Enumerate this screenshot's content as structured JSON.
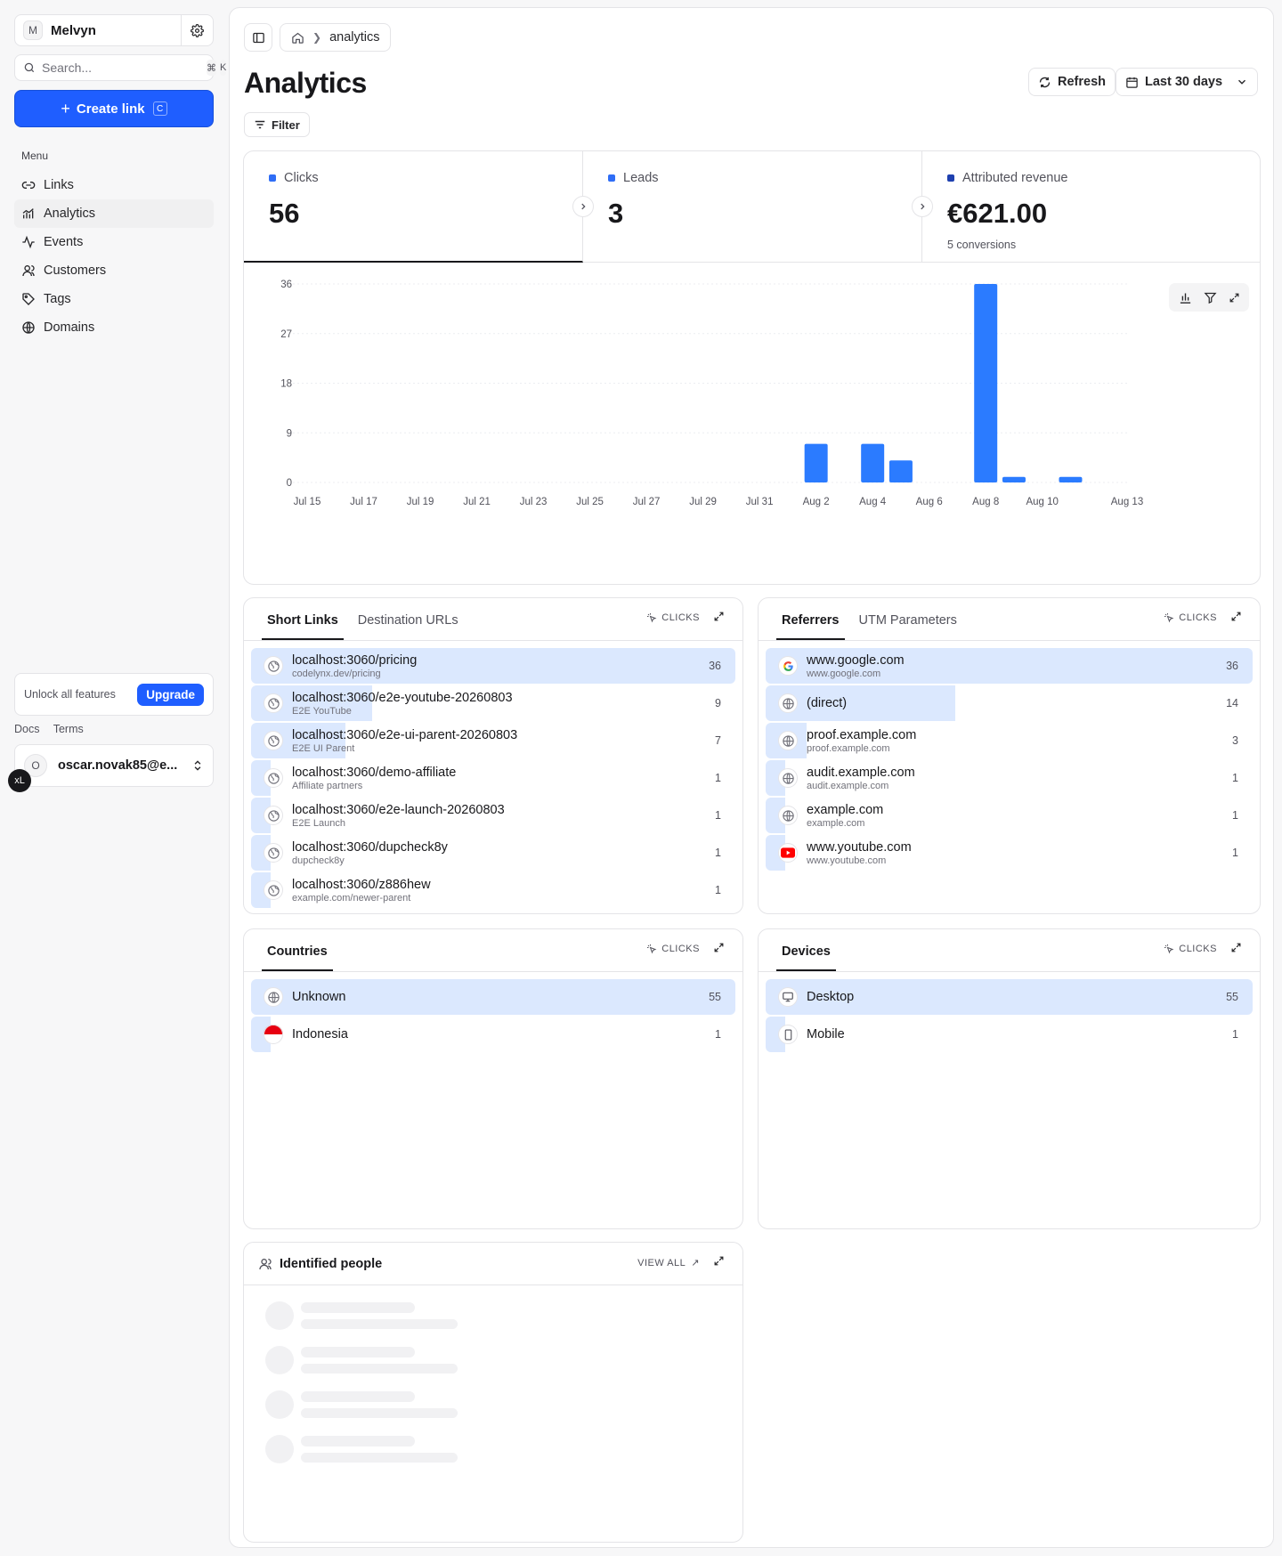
{
  "sidebar": {
    "workspace": {
      "avatar": "M",
      "name": "Melvyn"
    },
    "search": {
      "placeholder": "Search...",
      "kbd1": "⌘",
      "kbd2": "K"
    },
    "create": {
      "label": "Create link",
      "kbd": "C"
    },
    "menu_heading": "Menu",
    "items": [
      {
        "label": "Links",
        "icon": "link-icon"
      },
      {
        "label": "Analytics",
        "icon": "analytics-icon",
        "active": true
      },
      {
        "label": "Events",
        "icon": "activity-icon"
      },
      {
        "label": "Customers",
        "icon": "users-icon"
      },
      {
        "label": "Tags",
        "icon": "tag-icon"
      },
      {
        "label": "Domains",
        "icon": "globe-icon"
      }
    ],
    "unlock": {
      "text": "Unlock all features",
      "button": "Upgrade"
    },
    "footer_links": [
      "Docs",
      "Terms"
    ],
    "user": {
      "avatar": "O",
      "email": "oscar.novak85@e..."
    },
    "badge": "xL"
  },
  "header": {
    "breadcrumb": "analytics",
    "title": "Analytics",
    "refresh": "Refresh",
    "range": "Last 30 days",
    "filter": "Filter"
  },
  "stats": [
    {
      "label": "Clicks",
      "value": "56",
      "color": "#2f6df6",
      "sub": ""
    },
    {
      "label": "Leads",
      "value": "3",
      "color": "#2f6df6",
      "sub": ""
    },
    {
      "label": "Attributed revenue",
      "value": "€621.00",
      "color": "#1e40af",
      "sub": "5 conversions"
    }
  ],
  "chart_data": {
    "type": "bar",
    "categories": [
      "Jul 15",
      "Jul 16",
      "Jul 17",
      "Jul 18",
      "Jul 19",
      "Jul 20",
      "Jul 21",
      "Jul 22",
      "Jul 23",
      "Jul 24",
      "Jul 25",
      "Jul 26",
      "Jul 27",
      "Jul 28",
      "Jul 29",
      "Jul 30",
      "Jul 31",
      "Aug 1",
      "Aug 2",
      "Aug 3",
      "Aug 4",
      "Aug 5",
      "Aug 6",
      "Aug 7",
      "Aug 8",
      "Aug 9",
      "Aug 10",
      "Aug 11",
      "Aug 12",
      "Aug 13"
    ],
    "tick_labels": [
      "Jul 15",
      "Jul 17",
      "Jul 19",
      "Jul 21",
      "Jul 23",
      "Jul 25",
      "Jul 27",
      "Jul 29",
      "Jul 31",
      "Aug 2",
      "Aug 4",
      "Aug 6",
      "Aug 8",
      "Aug 10",
      "Aug 13"
    ],
    "values": [
      0,
      0,
      0,
      0,
      0,
      0,
      0,
      0,
      0,
      0,
      0,
      0,
      0,
      0,
      0,
      0,
      0,
      0,
      7,
      0,
      7,
      4,
      0,
      0,
      36,
      1,
      0,
      1,
      0,
      0
    ],
    "yticks": [
      0,
      9,
      18,
      27,
      36
    ],
    "ylim": [
      0,
      36
    ],
    "color": "#2b7bff",
    "grid": true
  },
  "short_links": {
    "tabs": [
      "Short Links",
      "Destination URLs"
    ],
    "metric": "CLICKS",
    "rows": [
      {
        "title": "localhost:3060/pricing",
        "sub": "codelynx.dev/pricing",
        "count": 36
      },
      {
        "title": "localhost:3060/e2e-youtube-20260803",
        "sub": "E2E YouTube",
        "count": 9
      },
      {
        "title": "localhost:3060/e2e-ui-parent-20260803",
        "sub": "E2E UI Parent",
        "count": 7
      },
      {
        "title": "localhost:3060/demo-affiliate",
        "sub": "Affiliate partners",
        "count": 1
      },
      {
        "title": "localhost:3060/e2e-launch-20260803",
        "sub": "E2E Launch",
        "count": 1
      },
      {
        "title": "localhost:3060/dupcheck8y",
        "sub": "dupcheck8y",
        "count": 1
      },
      {
        "title": "localhost:3060/z886hew",
        "sub": "example.com/newer-parent",
        "count": 1
      }
    ]
  },
  "referrers": {
    "tabs": [
      "Referrers",
      "UTM Parameters"
    ],
    "metric": "CLICKS",
    "rows": [
      {
        "title": "www.google.com",
        "sub": "www.google.com",
        "count": 36,
        "icon": "google-icon"
      },
      {
        "title": "(direct)",
        "sub": "",
        "count": 14,
        "icon": "globe-icon"
      },
      {
        "title": "proof.example.com",
        "sub": "proof.example.com",
        "count": 3,
        "icon": "globe-icon"
      },
      {
        "title": "audit.example.com",
        "sub": "audit.example.com",
        "count": 1,
        "icon": "globe-icon"
      },
      {
        "title": "example.com",
        "sub": "example.com",
        "count": 1,
        "icon": "globe-icon"
      },
      {
        "title": "www.youtube.com",
        "sub": "www.youtube.com",
        "count": 1,
        "icon": "youtube-icon"
      }
    ]
  },
  "countries": {
    "tabs": [
      "Countries"
    ],
    "metric": "CLICKS",
    "rows": [
      {
        "title": "Unknown",
        "sub": "",
        "count": 55,
        "icon": "globe-icon"
      },
      {
        "title": "Indonesia",
        "sub": "",
        "count": 1,
        "icon": "indonesia-flag-icon"
      }
    ]
  },
  "devices": {
    "tabs": [
      "Devices"
    ],
    "metric": "CLICKS",
    "rows": [
      {
        "title": "Desktop",
        "sub": "",
        "count": 55,
        "icon": "monitor-icon"
      },
      {
        "title": "Mobile",
        "sub": "",
        "count": 1,
        "icon": "phone-icon"
      }
    ]
  },
  "people": {
    "title": "Identified people",
    "view_all": "VIEW ALL"
  }
}
